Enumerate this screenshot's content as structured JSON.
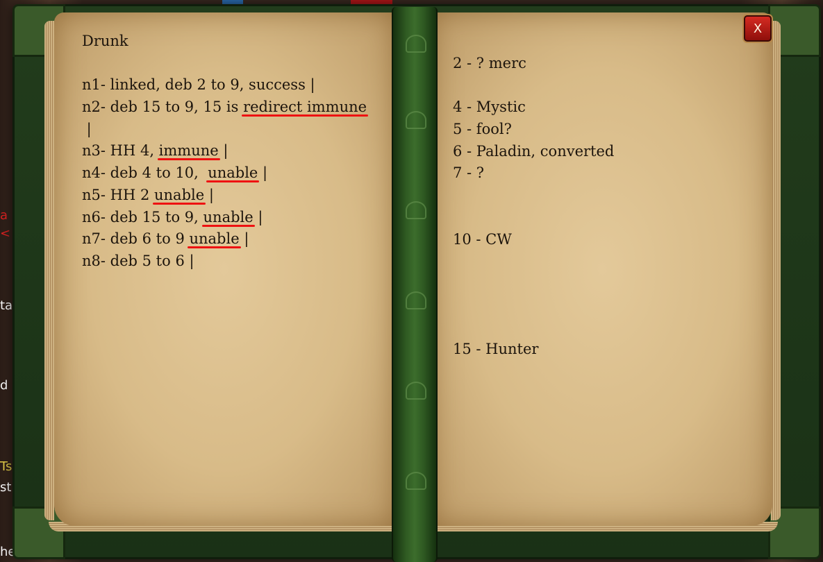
{
  "window": {
    "close_label": "X"
  },
  "left_page": {
    "lines": [
      [
        {
          "t": "Drunk"
        }
      ],
      [
        {
          "t": ""
        }
      ],
      [
        {
          "t": "n1- linked, deb 2 to 9, success |"
        }
      ],
      [
        {
          "t": "n2- deb 15 to 9, 15 is "
        },
        {
          "t": "redirect immune",
          "u": true
        }
      ],
      [
        {
          "t": " |"
        }
      ],
      [
        {
          "t": "n3- HH 4, "
        },
        {
          "t": "immune",
          "u": true
        },
        {
          "t": " |"
        }
      ],
      [
        {
          "t": "n4- deb 4 to 10,  "
        },
        {
          "t": "unable",
          "u": true
        },
        {
          "t": " |"
        }
      ],
      [
        {
          "t": "n5- HH 2 "
        },
        {
          "t": "unable",
          "u": true
        },
        {
          "t": " |"
        }
      ],
      [
        {
          "t": "n6- deb 15 to 9, "
        },
        {
          "t": "unable",
          "u": true
        },
        {
          "t": " |"
        }
      ],
      [
        {
          "t": "n7- deb 6 to 9 "
        },
        {
          "t": "unable",
          "u": true
        },
        {
          "t": " |"
        }
      ],
      [
        {
          "t": "n8- deb 5 to 6 |"
        }
      ]
    ]
  },
  "right_page": {
    "lines": [
      "2 - ? merc",
      "",
      "4 - Mystic",
      "5 - fool?",
      "6 - Paladin, converted",
      "7 - ?",
      "",
      "",
      "10 - CW",
      "",
      "",
      "",
      "",
      "15 - Hunter"
    ]
  },
  "side_fragments": [
    "a",
    "<",
    "ta",
    "d",
    "Ts",
    "st",
    "he"
  ],
  "colors": {
    "underline": "#e11111",
    "page": "#d8bb88",
    "cover": "#223c1c",
    "close_button": "#c0221a"
  }
}
